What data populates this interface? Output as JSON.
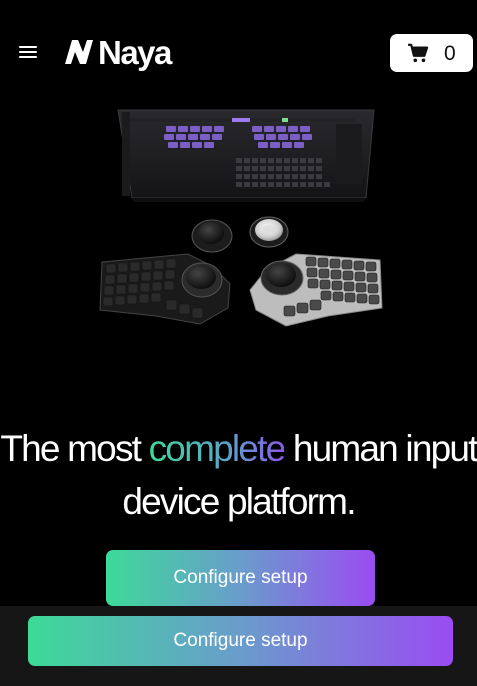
{
  "header": {
    "menu_icon": "hamburger-menu-icon",
    "logo_text": "Naya",
    "cart_icon": "shopping-cart-icon",
    "cart_count": "0"
  },
  "hero": {
    "image_subject": "Naya split keyboard setup with monitor and control modules"
  },
  "headline": {
    "part1": "The most ",
    "accent": "complete",
    "part2": " human input device platform.",
    "accent_gradient": [
      "#3fd89a",
      "#5aa7c9",
      "#8a5ae8"
    ]
  },
  "cta": {
    "main_label": "Configure setup",
    "sticky_label": "Configure setup"
  },
  "colors": {
    "background": "#000000",
    "sticky_bar": "#161616",
    "button_gradient_start": "#3dda98",
    "button_gradient_end": "#9a4cf2"
  }
}
